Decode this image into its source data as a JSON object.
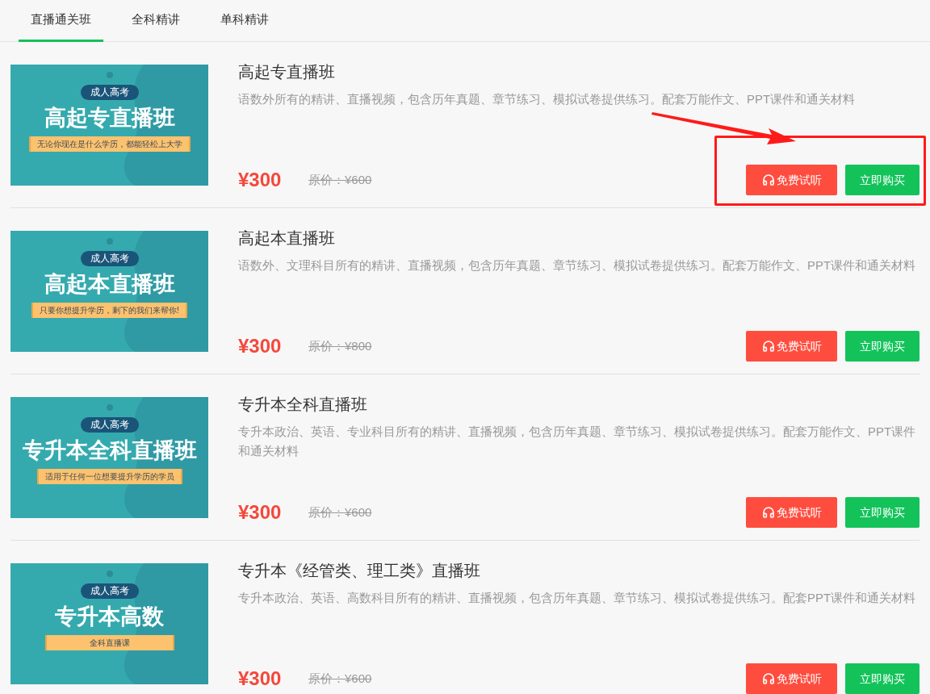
{
  "tabs": [
    {
      "label": "直播通关班",
      "selected": true
    },
    {
      "label": "全科精讲",
      "selected": false
    },
    {
      "label": "单科精讲",
      "selected": false
    }
  ],
  "courses": [
    {
      "banner": {
        "badge": "成人高考",
        "title": "高起专直播班",
        "slogan": "无论你现在是什么学历，都能轻松上大学"
      },
      "title": "高起专直播班",
      "description": "语数外所有的精讲、直播视频，包含历年真题、章节练习、模拟试卷提供练习。配套万能作文、PPT课件和通关材料",
      "price": "¥300",
      "original_price": "原价：¥600",
      "trial_button": "免费试听",
      "buy_button": "立即购买",
      "highlighted": true
    },
    {
      "banner": {
        "badge": "成人高考",
        "title": "高起本直播班",
        "slogan": "只要你想提升学历，剩下的我们来帮你!"
      },
      "title": "高起本直播班",
      "description": "语数外、文理科目所有的精讲、直播视频，包含历年真题、章节练习、模拟试卷提供练习。配套万能作文、PPT课件和通关材料",
      "price": "¥300",
      "original_price": "原价：¥800",
      "trial_button": "免费试听",
      "buy_button": "立即购买",
      "highlighted": false
    },
    {
      "banner": {
        "badge": "成人高考",
        "title": "专升本全科直播班",
        "slogan": "适用于任何一位想要提升学历的学员"
      },
      "title": "专升本全科直播班",
      "description": "专升本政治、英语、专业科目所有的精讲、直播视频，包含历年真题、章节练习、模拟试卷提供练习。配套万能作文、PPT课件和通关材料",
      "price": "¥300",
      "original_price": "原价：¥600",
      "trial_button": "免费试听",
      "buy_button": "立即购买",
      "highlighted": false
    },
    {
      "banner": {
        "badge": "成人高考",
        "title": "专升本高数",
        "slogan": "全科直播课"
      },
      "title": "专升本《经管类、理工类》直播班",
      "description": "专升本政治、英语、高数科目所有的精讲、直播视频，包含历年真题、章节练习、模拟试卷提供练习。配套PPT课件和通关材料",
      "price": "¥300",
      "original_price": "原价：¥600",
      "trial_button": "免费试听",
      "buy_button": "立即购买",
      "highlighted": false
    }
  ]
}
